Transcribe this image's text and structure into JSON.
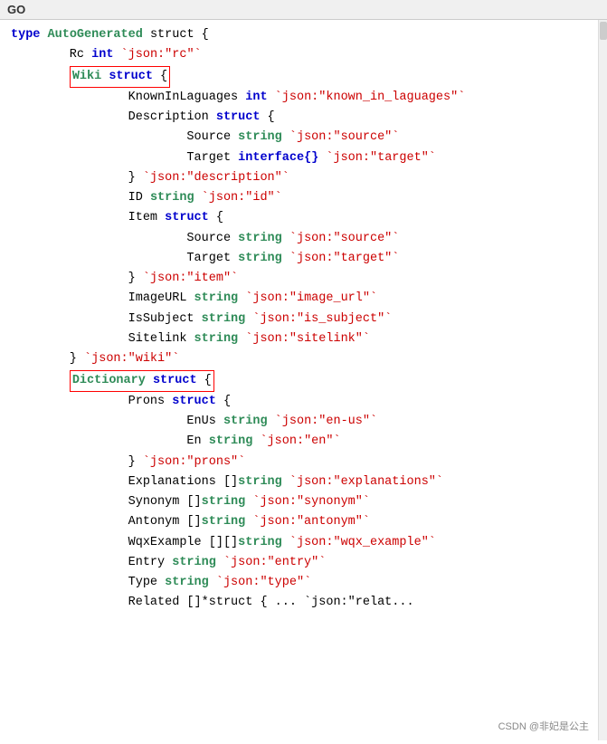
{
  "titleBar": {
    "label": "GO"
  },
  "watermark": "CSDN @非妃是公主",
  "code": {
    "lines": [
      {
        "id": 1,
        "tokens": [
          {
            "text": "type ",
            "class": "kw"
          },
          {
            "text": "AutoGenerated ",
            "class": "type-name"
          },
          {
            "text": "struct {",
            "class": "field"
          }
        ]
      },
      {
        "id": 2,
        "tokens": [
          {
            "text": "        Rc ",
            "class": "field"
          },
          {
            "text": "int",
            "class": "kw"
          },
          {
            "text": " `json:\"rc\"`",
            "class": "json-tag"
          }
        ]
      },
      {
        "id": 3,
        "tokens": [
          {
            "text": "        ",
            "class": "field"
          },
          {
            "text": "HIGHLIGHTED:Wiki struct {",
            "class": "highlighted"
          }
        ]
      },
      {
        "id": 4,
        "tokens": [
          {
            "text": "                KnownInLaguages ",
            "class": "field"
          },
          {
            "text": "int",
            "class": "kw"
          },
          {
            "text": " `json:\"known_in_laguages\"`",
            "class": "json-tag"
          }
        ]
      },
      {
        "id": 5,
        "tokens": [
          {
            "text": "                Description ",
            "class": "field"
          },
          {
            "text": "struct",
            "class": "kw"
          },
          {
            "text": " {",
            "class": "field"
          }
        ]
      },
      {
        "id": 6,
        "tokens": [
          {
            "text": "                        Source ",
            "class": "field"
          },
          {
            "text": "string",
            "class": "str-type"
          },
          {
            "text": " `json:\"source\"`",
            "class": "json-tag"
          }
        ]
      },
      {
        "id": 7,
        "tokens": [
          {
            "text": "                        Target ",
            "class": "field"
          },
          {
            "text": "interface{}",
            "class": "kw"
          },
          {
            "text": " `json:\"target\"`",
            "class": "json-tag"
          }
        ]
      },
      {
        "id": 8,
        "tokens": [
          {
            "text": "                } `json:\"description\"`",
            "class": "json-tag-brace"
          }
        ]
      },
      {
        "id": 9,
        "tokens": [
          {
            "text": "                ID ",
            "class": "field"
          },
          {
            "text": "string",
            "class": "str-type"
          },
          {
            "text": " `json:\"id\"`",
            "class": "json-tag"
          }
        ]
      },
      {
        "id": 10,
        "tokens": [
          {
            "text": "                Item ",
            "class": "field"
          },
          {
            "text": "struct",
            "class": "kw"
          },
          {
            "text": " {",
            "class": "field"
          }
        ]
      },
      {
        "id": 11,
        "tokens": [
          {
            "text": "                        Source ",
            "class": "field"
          },
          {
            "text": "string",
            "class": "str-type"
          },
          {
            "text": " `json:\"source\"`",
            "class": "json-tag"
          }
        ]
      },
      {
        "id": 12,
        "tokens": [
          {
            "text": "                        Target ",
            "class": "field"
          },
          {
            "text": "string",
            "class": "str-type"
          },
          {
            "text": " `json:\"target\"`",
            "class": "json-tag"
          }
        ]
      },
      {
        "id": 13,
        "tokens": [
          {
            "text": "                } `json:\"item\"`",
            "class": "json-tag-brace"
          }
        ]
      },
      {
        "id": 14,
        "tokens": [
          {
            "text": "                ImageURL ",
            "class": "field"
          },
          {
            "text": "string",
            "class": "str-type"
          },
          {
            "text": " `json:\"image_url\"`",
            "class": "json-tag"
          }
        ]
      },
      {
        "id": 15,
        "tokens": [
          {
            "text": "                IsSubject ",
            "class": "field"
          },
          {
            "text": "string",
            "class": "str-type"
          },
          {
            "text": " `json:\"is_subject\"`",
            "class": "json-tag"
          }
        ]
      },
      {
        "id": 16,
        "tokens": [
          {
            "text": "                Sitelink ",
            "class": "field"
          },
          {
            "text": "string",
            "class": "str-type"
          },
          {
            "text": " `json:\"sitelink\"`",
            "class": "json-tag"
          }
        ]
      },
      {
        "id": 17,
        "tokens": [
          {
            "text": "        } `json:\"wiki\"`",
            "class": "json-tag-brace"
          }
        ]
      },
      {
        "id": 18,
        "tokens": [
          {
            "text": "        ",
            "class": "field"
          },
          {
            "text": "HIGHLIGHTED:Dictionary struct {",
            "class": "highlighted"
          }
        ]
      },
      {
        "id": 19,
        "tokens": [
          {
            "text": "                Prons ",
            "class": "field"
          },
          {
            "text": "struct",
            "class": "kw"
          },
          {
            "text": " {",
            "class": "field"
          }
        ]
      },
      {
        "id": 20,
        "tokens": [
          {
            "text": "                        EnUs ",
            "class": "field"
          },
          {
            "text": "string",
            "class": "str-type"
          },
          {
            "text": " `json:\"en-us\"`",
            "class": "json-tag"
          }
        ]
      },
      {
        "id": 21,
        "tokens": [
          {
            "text": "                        En ",
            "class": "field"
          },
          {
            "text": "string",
            "class": "str-type"
          },
          {
            "text": " `json:\"en\"`",
            "class": "json-tag"
          }
        ]
      },
      {
        "id": 22,
        "tokens": [
          {
            "text": "                } `json:\"prons\"`",
            "class": "json-tag-brace"
          }
        ]
      },
      {
        "id": 23,
        "tokens": [
          {
            "text": "                Explanations []",
            "class": "field"
          },
          {
            "text": "string",
            "class": "str-type"
          },
          {
            "text": " `json:\"explanations\"`",
            "class": "json-tag"
          }
        ]
      },
      {
        "id": 24,
        "tokens": [
          {
            "text": "                Synonym []",
            "class": "field"
          },
          {
            "text": "string",
            "class": "str-type"
          },
          {
            "text": " `json:\"synonym\"`",
            "class": "json-tag"
          }
        ]
      },
      {
        "id": 25,
        "tokens": [
          {
            "text": "                Antonym []",
            "class": "field"
          },
          {
            "text": "string",
            "class": "str-type"
          },
          {
            "text": " `json:\"antonym\"`",
            "class": "json-tag"
          }
        ]
      },
      {
        "id": 26,
        "tokens": [
          {
            "text": "                WqxExample [][]",
            "class": "field"
          },
          {
            "text": "string",
            "class": "str-type"
          },
          {
            "text": " `json:\"wqx_example\"`",
            "class": "json-tag"
          }
        ]
      },
      {
        "id": 27,
        "tokens": [
          {
            "text": "                Entry ",
            "class": "field"
          },
          {
            "text": "string",
            "class": "str-type"
          },
          {
            "text": " `json:\"entry\"`",
            "class": "json-tag"
          }
        ]
      },
      {
        "id": 28,
        "tokens": [
          {
            "text": "                Type ",
            "class": "field"
          },
          {
            "text": "string",
            "class": "str-type"
          },
          {
            "text": " `json:\"type\"`",
            "class": "json-tag"
          }
        ]
      },
      {
        "id": 29,
        "tokens": [
          {
            "text": "                Related []*struct { ... `json:\"relat...",
            "class": "field"
          }
        ]
      }
    ]
  }
}
